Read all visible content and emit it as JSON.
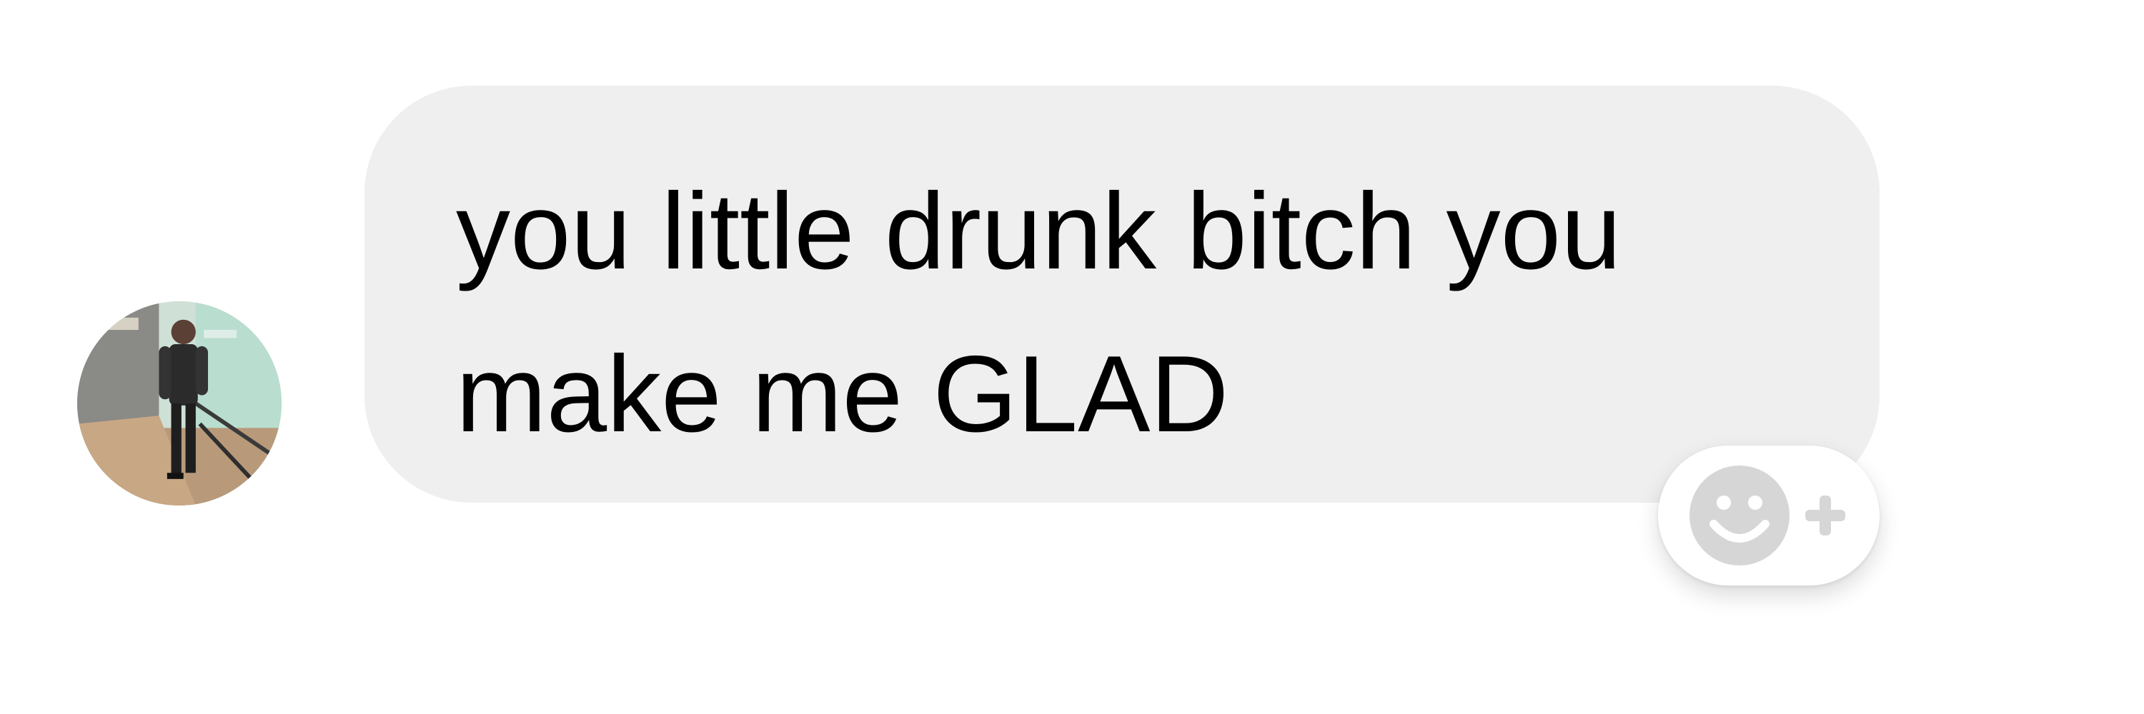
{
  "message": {
    "text": "you little drunk bitch you\nmake me GLAD",
    "bubble_color": "#efefef",
    "text_color": "#000000"
  },
  "sender": {
    "avatar_icon": "profile-photo"
  },
  "reaction": {
    "icon": "add-reaction-icon",
    "icon_color": "#d6d6d6"
  }
}
